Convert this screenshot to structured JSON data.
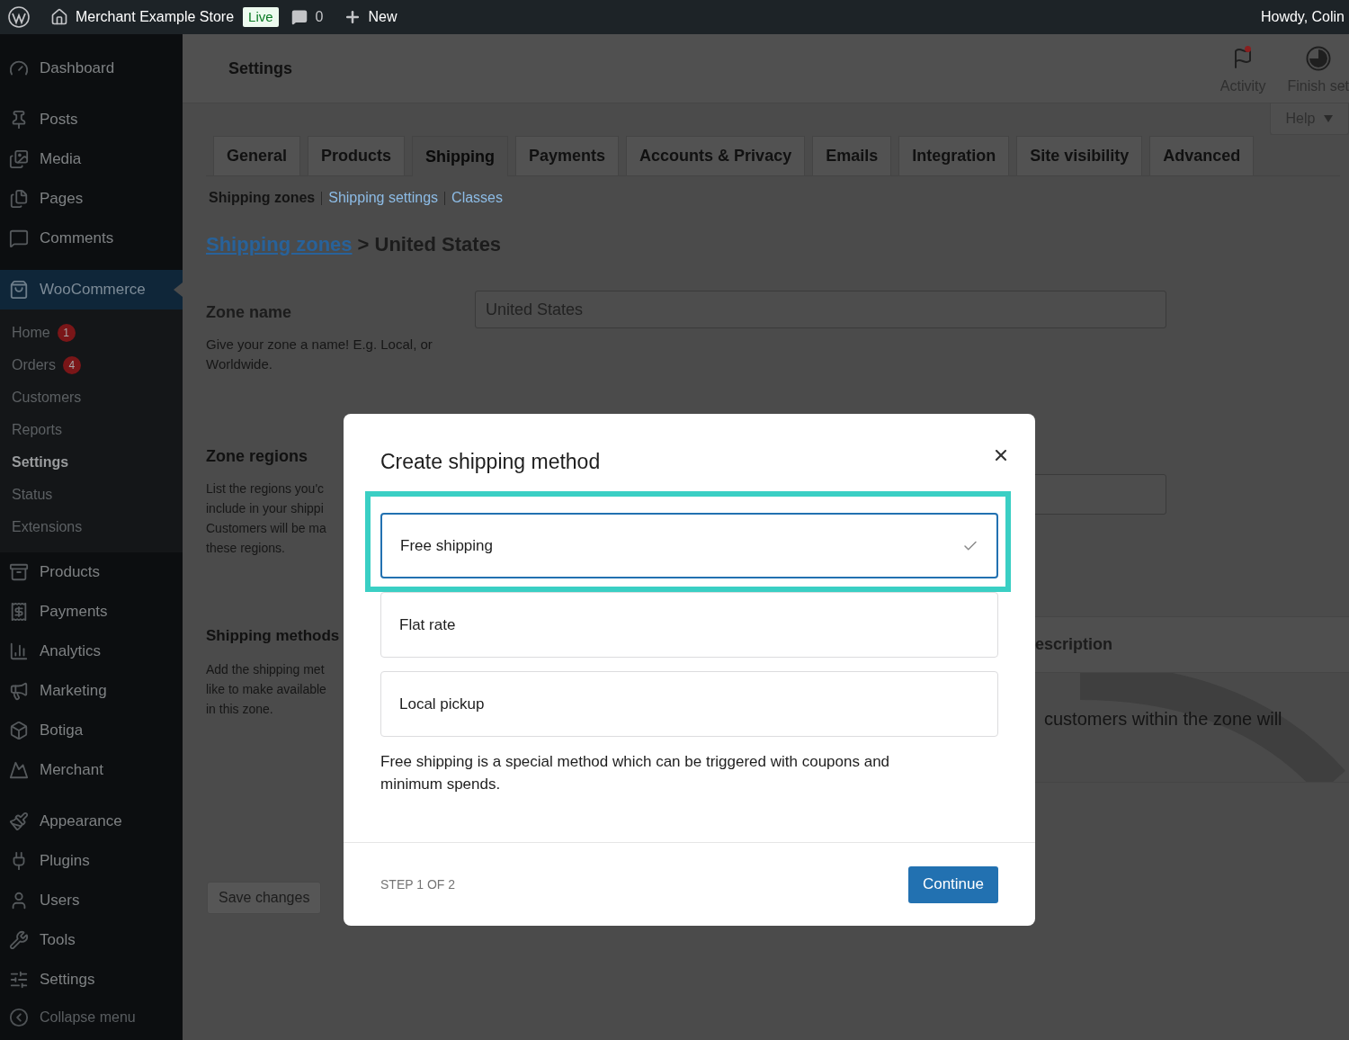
{
  "top_bar": {
    "site_name": "Merchant Example Store",
    "status_badge": "Live",
    "comment_count": "0",
    "new_label": "New",
    "greeting": "Howdy, Colin"
  },
  "sidebar": {
    "groups": [
      {
        "items": [
          {
            "label": "Dashboard",
            "selected": false
          }
        ]
      },
      {
        "items": [
          {
            "label": "Posts",
            "selected": false
          },
          {
            "label": "Media",
            "selected": false
          },
          {
            "label": "Pages",
            "selected": false
          },
          {
            "label": "Comments",
            "selected": false
          }
        ]
      },
      {
        "items": [
          {
            "label": "WooCommerce",
            "selected": true,
            "children": [
              {
                "label": "Home",
                "badge": "1",
                "selected": false
              },
              {
                "label": "Orders",
                "badge": "4",
                "selected": false
              },
              {
                "label": "Customers",
                "selected": false
              },
              {
                "label": "Reports",
                "selected": false
              },
              {
                "label": "Settings",
                "selected": true
              },
              {
                "label": "Status",
                "selected": false
              },
              {
                "label": "Extensions",
                "selected": false
              }
            ]
          },
          {
            "label": "Products",
            "selected": false
          },
          {
            "label": "Payments",
            "selected": false
          },
          {
            "label": "Analytics",
            "selected": false
          },
          {
            "label": "Marketing",
            "selected": false
          },
          {
            "label": "Botiga",
            "selected": false
          },
          {
            "label": "Merchant",
            "selected": false
          }
        ]
      },
      {
        "items": [
          {
            "label": "Appearance",
            "selected": false
          },
          {
            "label": "Plugins",
            "selected": false
          },
          {
            "label": "Users",
            "selected": false
          },
          {
            "label": "Tools",
            "selected": false
          },
          {
            "label": "Settings",
            "selected": false
          }
        ]
      }
    ],
    "collapse_label": "Collapse menu"
  },
  "header": {
    "title": "Settings",
    "actions": [
      {
        "label": "Activity",
        "has_notification": true
      },
      {
        "label": "Finish set",
        "has_notification": false
      }
    ],
    "help_label": "Help"
  },
  "tabs": [
    {
      "label": "General",
      "selected": false
    },
    {
      "label": "Products",
      "selected": false
    },
    {
      "label": "Shipping",
      "selected": true
    },
    {
      "label": "Payments",
      "selected": false
    },
    {
      "label": "Accounts & Privacy",
      "selected": false
    },
    {
      "label": "Emails",
      "selected": false
    },
    {
      "label": "Integration",
      "selected": false
    },
    {
      "label": "Site visibility",
      "selected": false
    },
    {
      "label": "Advanced",
      "selected": false
    }
  ],
  "subnav": [
    {
      "label": "Shipping zones",
      "selected": true
    },
    {
      "label": "Shipping settings",
      "selected": false
    },
    {
      "label": "Classes",
      "selected": false
    }
  ],
  "breadcrumb": {
    "link": "Shipping zones",
    "current": "> United States"
  },
  "zone_name": {
    "label": "Zone name",
    "description": "Give your zone a name! E.g. Local, or Worldwide.",
    "value": "United States"
  },
  "zone_regions": {
    "label": "Zone regions",
    "description_lines": [
      "List the regions you'c",
      "include in your shippi",
      "Customers will be ma",
      "these regions."
    ]
  },
  "shipping_methods": {
    "label": "Shipping methods",
    "description_lines": [
      "Add the shipping met",
      "like to make available",
      "in this zone."
    ],
    "table": {
      "column_header": "escription",
      "message": "customers within the zone will"
    }
  },
  "save_button": {
    "label": "Save changes",
    "disabled": true
  },
  "modal": {
    "title": "Create shipping method",
    "options": [
      {
        "label": "Free shipping",
        "selected": true,
        "highlighted": true
      },
      {
        "label": "Flat rate",
        "selected": false,
        "highlighted": false
      },
      {
        "label": "Local pickup",
        "selected": false,
        "highlighted": false
      }
    ],
    "description": "Free shipping is a special method which can be triggered with coupons and minimum spends.",
    "step": "STEP 1 OF 2",
    "continue_label": "Continue"
  }
}
